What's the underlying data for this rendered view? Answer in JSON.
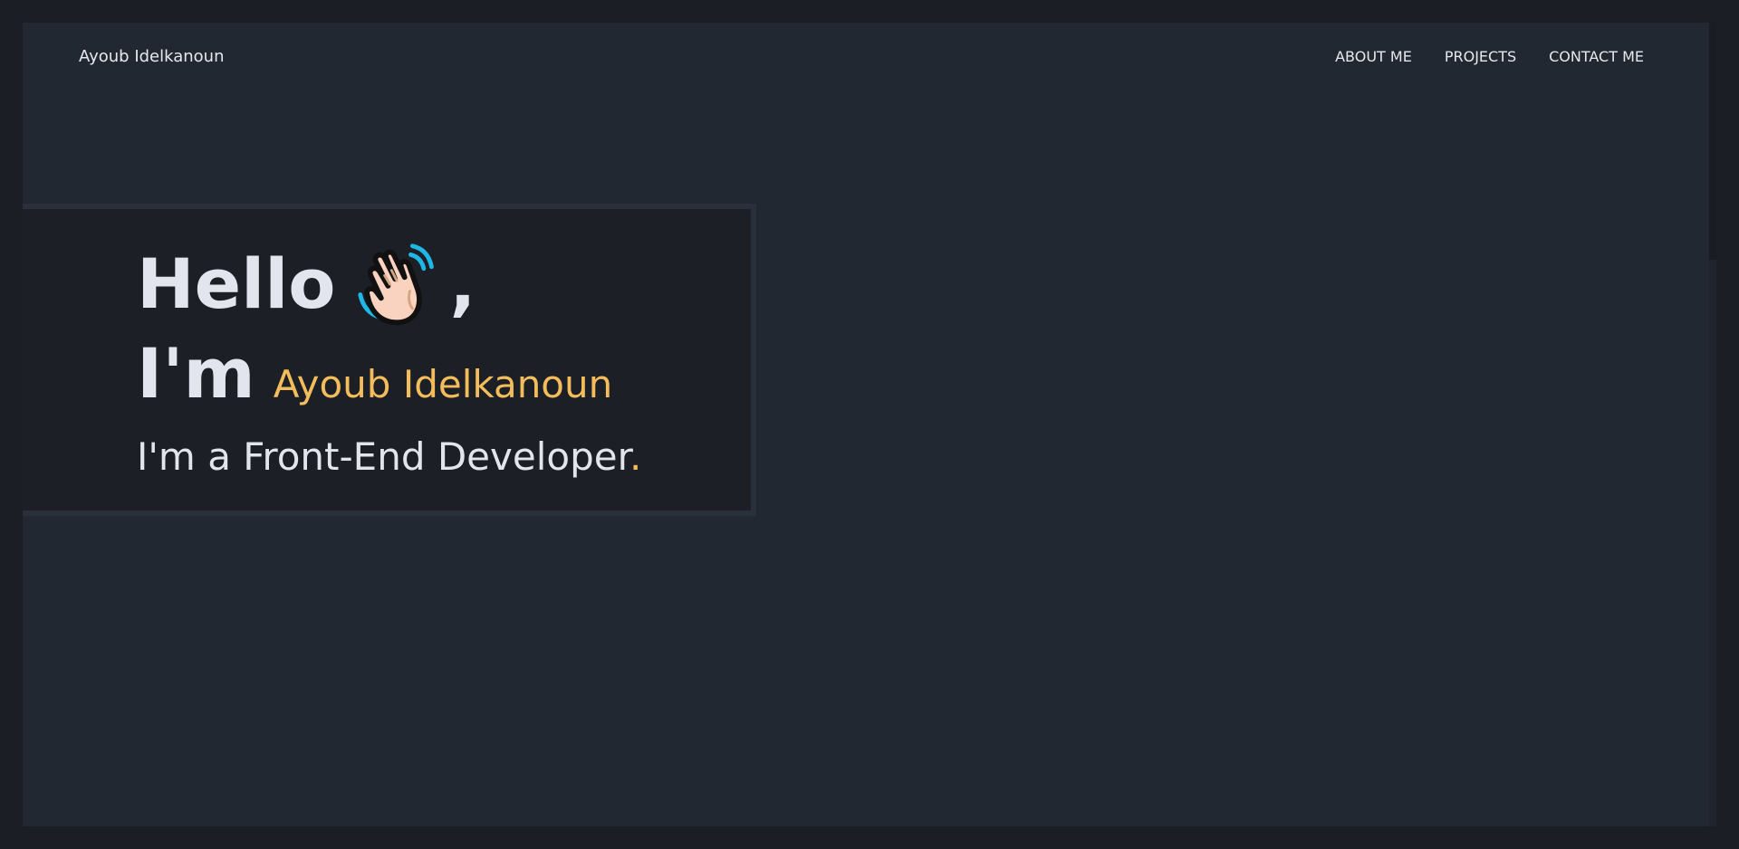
{
  "header": {
    "brand": "Ayoub Idelkanoun",
    "nav": [
      {
        "label": "ABOUT ME"
      },
      {
        "label": "PROJECTS"
      },
      {
        "label": "CONTACT ME"
      }
    ]
  },
  "hero": {
    "greeting": "Hello",
    "greeting_suffix": ",",
    "greeting_icon": "waving-hand-icon",
    "intro_prefix": "I'm",
    "name": "Ayoub Idelkanoun",
    "role": "I'm a Front-End Developer",
    "role_suffix": "."
  },
  "colors": {
    "background": "#222832",
    "outer": "#1b1e25",
    "card": "#1c1f26",
    "card_border": "#2a303b",
    "accent": "#f3bd5b",
    "text": "#e2e5ee"
  }
}
